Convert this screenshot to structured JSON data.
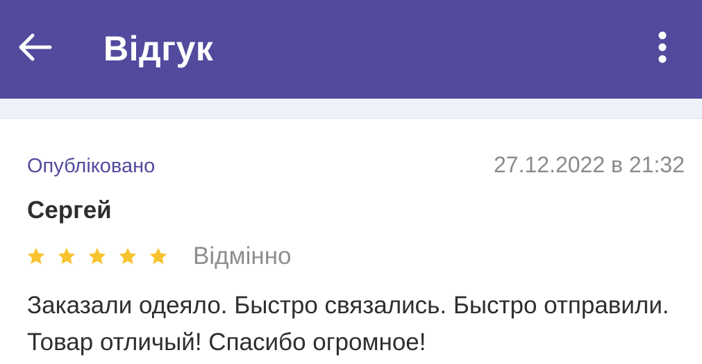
{
  "header": {
    "title": "Відгук",
    "background_color": "#514a9d",
    "back_icon": "arrow-left-icon",
    "menu_icon": "more-vertical-icon"
  },
  "review": {
    "status": "Опубліковано",
    "date": "27.12.2022 в 21:32",
    "author": "Сергей",
    "rating": 5,
    "rating_max": 5,
    "rating_label": "Відмінно",
    "star_color": "#f7c32e",
    "text": "Заказали одеяло. Быстро связались. Быстро отправили. Товар отличый! Спасибо огромное!"
  }
}
